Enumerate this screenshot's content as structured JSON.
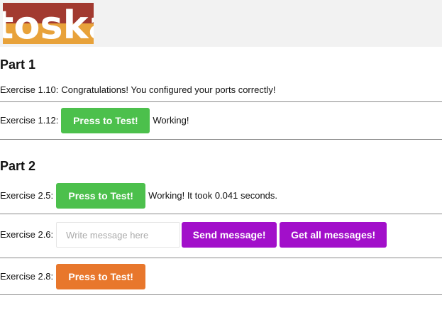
{
  "logo": {
    "text": "itoska",
    "colors": {
      "top": "#a23a30",
      "bottom": "#e8a23a"
    }
  },
  "part1": {
    "heading": "Part 1",
    "ex_1_10": {
      "label": "Exercise 1.10:",
      "message": "Congratulations! You configured your ports correctly!"
    },
    "ex_1_12": {
      "label": "Exercise 1.12:",
      "button": "Press to Test!",
      "status": "Working!"
    }
  },
  "part2": {
    "heading": "Part 2",
    "ex_2_5": {
      "label": "Exercise 2.5:",
      "button": "Press to Test!",
      "status": "Working! It took 0.041 seconds."
    },
    "ex_2_6": {
      "label": "Exercise 2.6:",
      "input_placeholder": "Write message here",
      "input_value": "",
      "send_button": "Send message!",
      "get_button": "Get all messages!"
    },
    "ex_2_8": {
      "label": "Exercise 2.8:",
      "button": "Press to Test!"
    }
  },
  "colors": {
    "green": "#4cc04c",
    "purple": "#a20fca",
    "orange": "#e8772c"
  }
}
